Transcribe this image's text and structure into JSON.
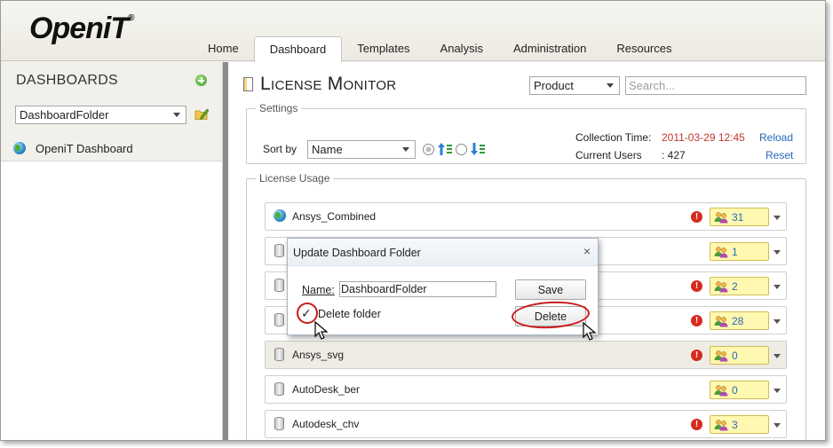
{
  "app": {
    "logo_text_a": "Open",
    "logo_text_b": "iT",
    "logo_reg": "®"
  },
  "nav": {
    "tabs": [
      {
        "label": "Home"
      },
      {
        "label": "Dashboard",
        "active": true
      },
      {
        "label": "Templates"
      },
      {
        "label": "Analysis"
      },
      {
        "label": "Administration"
      },
      {
        "label": "Resources"
      }
    ]
  },
  "sidebar": {
    "title": "DASHBOARDS",
    "folder_select_value": "DashboardFolder",
    "items": [
      {
        "label": "OpeniT Dashboard",
        "icon": "globe-icon"
      }
    ]
  },
  "main": {
    "title": "License Monitor",
    "product_select_value": "Product",
    "search_placeholder": "Search...",
    "settings": {
      "legend": "Settings",
      "sort_label": "Sort by",
      "sort_value": "Name",
      "collection_label": "Collection Time:",
      "collection_value": "2011-03-29 12:45",
      "users_label": "Current Users",
      "users_value": ": 427",
      "reload_label": "Reload",
      "reset_label": "Reset"
    },
    "usage": {
      "legend": "License Usage",
      "rows": [
        {
          "name": "Ansys_Combined",
          "icon": "globe-icon",
          "alert": true,
          "count": "31"
        },
        {
          "name": "",
          "icon": "database-icon",
          "alert": false,
          "count": "1"
        },
        {
          "name": "",
          "icon": "database-icon",
          "alert": true,
          "count": "2"
        },
        {
          "name": "",
          "icon": "database-icon",
          "alert": true,
          "count": "28"
        },
        {
          "name": "Ansys_svg",
          "icon": "database-icon",
          "alert": true,
          "count": "0",
          "highlighted": true
        },
        {
          "name": "AutoDesk_ber",
          "icon": "database-icon",
          "alert": false,
          "count": "0"
        },
        {
          "name": "Autodesk_chv",
          "icon": "database-icon",
          "alert": true,
          "count": "3"
        }
      ]
    }
  },
  "dialog": {
    "title": "Update Dashboard Folder",
    "close_label": "×",
    "name_label": "Name:",
    "name_value": "DashboardFolder",
    "delete_check": "✓",
    "delete_label": "Delete folder",
    "save_label": "Save",
    "delete_label_btn": "Delete"
  },
  "colors": {
    "alert": "#d72a1e",
    "link": "#2769b8",
    "annotation": "#c81b1b",
    "badge_bg": "#fff8b0"
  }
}
